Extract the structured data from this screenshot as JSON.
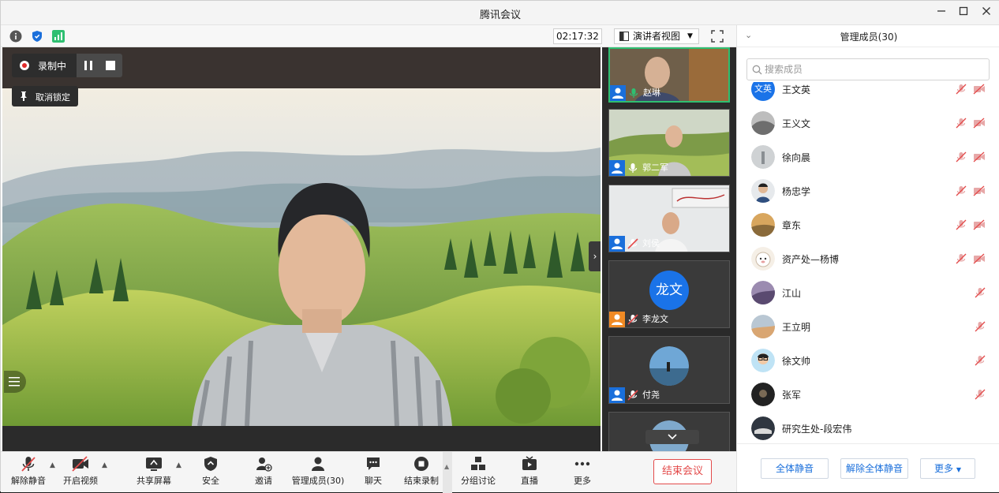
{
  "window": {
    "title": "腾讯会议"
  },
  "infobar": {
    "timer": "02:17:32",
    "view_label": "演讲者视图"
  },
  "recording": {
    "status": "录制中",
    "unpin_label": "取消锁定"
  },
  "thumbnails": [
    {
      "name": "赵琳",
      "mic": "on"
    },
    {
      "name": "郭二军",
      "mic": "on"
    },
    {
      "name": "刘侯",
      "mic": "muted"
    },
    {
      "name": "李龙文",
      "mic": "muted",
      "avatar_text": "龙文"
    },
    {
      "name": "付尧",
      "mic": "muted"
    }
  ],
  "toolbar": {
    "unmute": "解除静音",
    "start_video": "开启视频",
    "share_screen": "共享屏幕",
    "security": "安全",
    "invite": "邀请",
    "manage_members": "管理成员(30)",
    "chat": "聊天",
    "stop_recording": "结束录制",
    "breakout": "分组讨论",
    "live": "直播",
    "more": "更多",
    "end_meeting": "结束会议"
  },
  "panel": {
    "title": "管理成员(30)",
    "search_placeholder": "搜索成员",
    "members": [
      {
        "name": "王文英",
        "avatar_text": "文英"
      },
      {
        "name": "王义文"
      },
      {
        "name": "徐向晨"
      },
      {
        "name": "杨忠学"
      },
      {
        "name": "章东"
      },
      {
        "name": "资产处—杨博"
      },
      {
        "name": "江山"
      },
      {
        "name": "王立明"
      },
      {
        "name": "徐文帅"
      },
      {
        "name": "张军"
      },
      {
        "name": "研究生处-段宏伟"
      }
    ],
    "mute_all": "全体静音",
    "unmute_all": "解除全体静音",
    "more": "更多"
  },
  "colors": {
    "accent": "#1a6fdb",
    "end": "#e34a4a",
    "active_speaker": "#2fbf71"
  }
}
